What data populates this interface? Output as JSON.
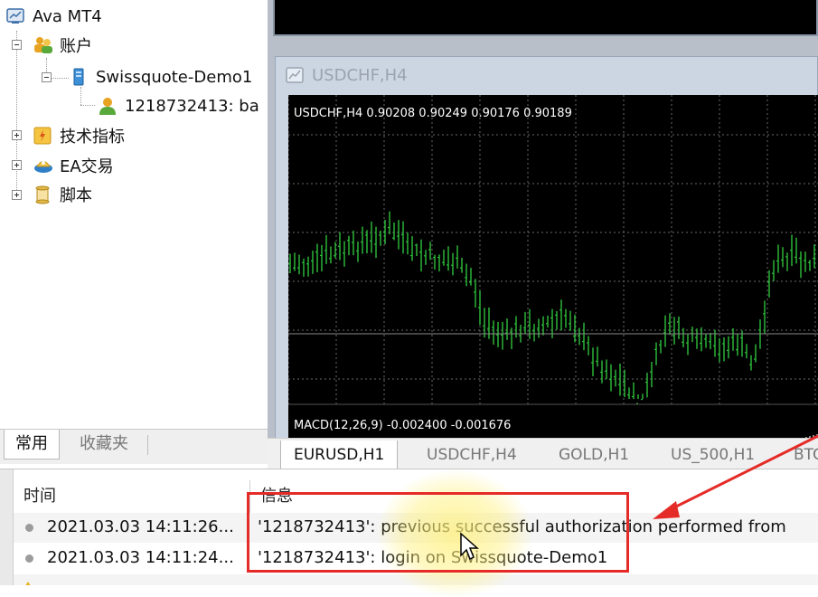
{
  "navigator": {
    "root": "Ava MT4",
    "accounts": "账户",
    "server": "Swissquote-Demo1",
    "account_entry": "1218732413: ba",
    "indicators": "技术指标",
    "expert_advisors": "EA交易",
    "scripts": "脚本",
    "tabs": {
      "common": "常用",
      "favorites": "收藏夹"
    }
  },
  "chart_window": {
    "title": "USDCHF,H4",
    "info_line": "USDCHF,H4  0.90208 0.90249 0.90176 0.90189",
    "macd_label": "MACD(12,26,9) -0.002400 -0.001676"
  },
  "chart_tabs": [
    "EURUSD,H1",
    "USDCHF,H4",
    "GOLD,H1",
    "US_500,H1",
    "BTC"
  ],
  "journal": {
    "headers": {
      "time": "时间",
      "message": "信息"
    },
    "rows": [
      {
        "time": "2021.03.03 14:11:26...",
        "message": "'1218732413': previous successful authorization performed from"
      },
      {
        "time": "2021.03.03 14:11:24...",
        "message": "'1218732413': login on Swissquote-Demo1"
      }
    ]
  },
  "colors": {
    "candle": "#2fbf3b",
    "highlight": "#e52b28",
    "arrow": "#e52b28"
  }
}
